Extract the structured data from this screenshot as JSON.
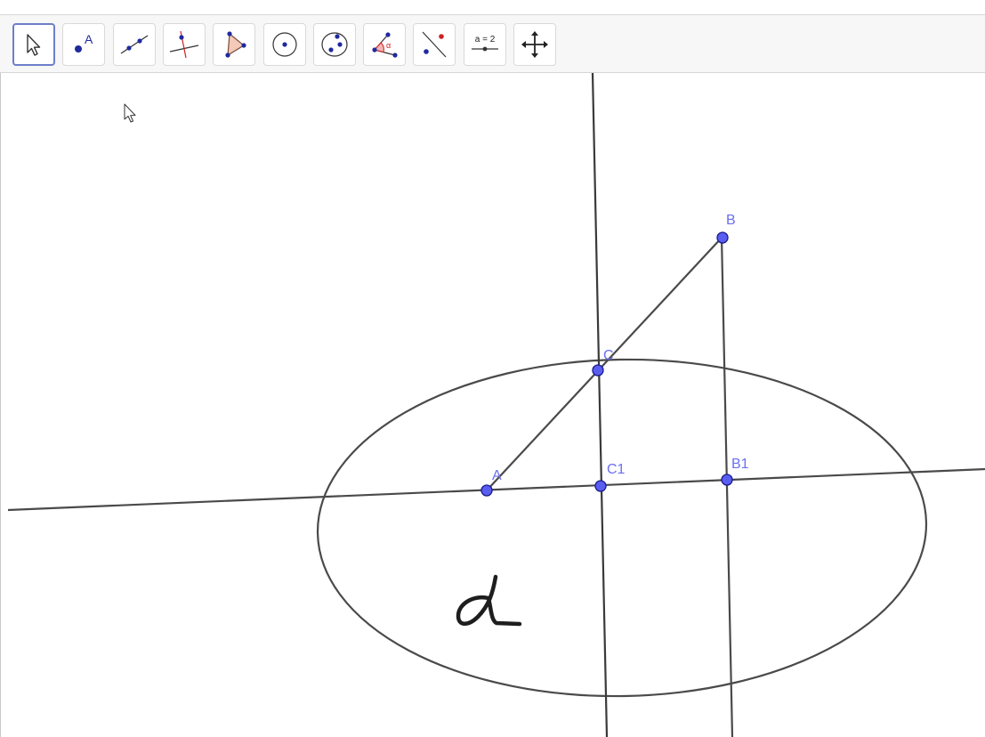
{
  "toolbar": {
    "tools": [
      {
        "name": "Move",
        "icon": "move-arrow-icon",
        "active": true
      },
      {
        "name": "Point",
        "icon": "point-icon",
        "icon_text": "A"
      },
      {
        "name": "Line",
        "icon": "line-through-two-points-icon"
      },
      {
        "name": "Perpendicular Line",
        "icon": "perpendicular-line-icon"
      },
      {
        "name": "Polygon",
        "icon": "polygon-icon"
      },
      {
        "name": "Circle with Center",
        "icon": "circle-center-point-icon"
      },
      {
        "name": "Circle through 3 Points",
        "icon": "circle-three-points-icon"
      },
      {
        "name": "Angle",
        "icon": "angle-icon",
        "icon_text": "α"
      },
      {
        "name": "Reflect about Line",
        "icon": "reflect-about-line-icon"
      },
      {
        "name": "Slider",
        "icon": "slider-icon",
        "icon_text": "a = 2"
      },
      {
        "name": "Move Graphics View",
        "icon": "move-graphics-view-icon"
      }
    ]
  },
  "construction": {
    "points": {
      "A": {
        "label": "A"
      },
      "B": {
        "label": "B"
      },
      "C": {
        "label": "C"
      },
      "C1": {
        "label": "C1"
      },
      "B1": {
        "label": "B1"
      }
    },
    "handwritten_note": "α"
  },
  "colors": {
    "point_fill": "#5a5ef0",
    "point_stroke": "#1a1a8c",
    "label": "#6a6ff0",
    "line": "#4a4a4a",
    "toolbar_bg": "#f7f7f7",
    "active_border": "#6c7fc9",
    "icon_blue": "#1f2a9e",
    "icon_red": "#d02020"
  }
}
